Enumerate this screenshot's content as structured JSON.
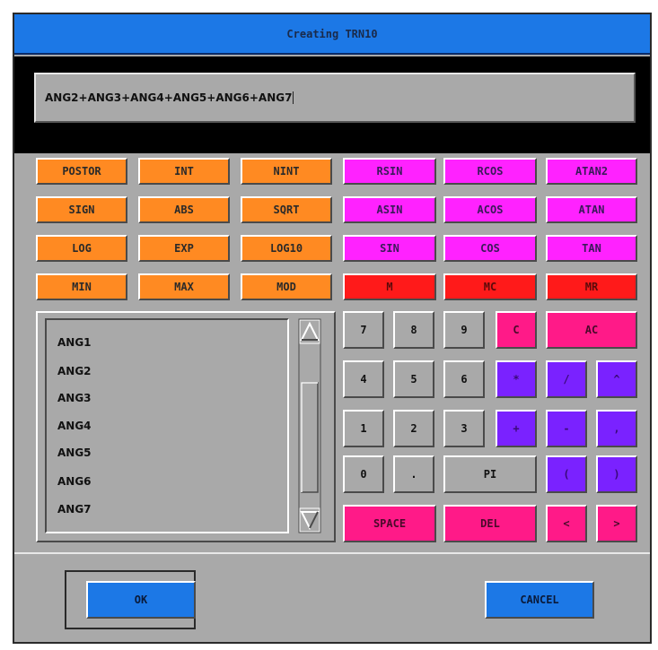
{
  "dialog": {
    "title": "Creating TRN10"
  },
  "expression": {
    "value": "ANG2+ANG3+ANG4+ANG5+ANG6+ANG7"
  },
  "function_buttons": [
    [
      "POSTOR",
      "INT",
      "NINT",
      "RSIN",
      "RCOS",
      "ATAN2"
    ],
    [
      "SIGN",
      "ABS",
      "SQRT",
      "ASIN",
      "ACOS",
      "ATAN"
    ],
    [
      "LOG",
      "EXP",
      "LOG10",
      "SIN",
      "COS",
      "TAN"
    ],
    [
      "MIN",
      "MAX",
      "MOD",
      "M",
      "MC",
      "MR"
    ]
  ],
  "variables": [
    "ANG1",
    "ANG2",
    "ANG3",
    "ANG4",
    "ANG5",
    "ANG6",
    "ANG7"
  ],
  "keypad": {
    "row1": [
      "7",
      "8",
      "9",
      "C",
      "AC"
    ],
    "row2": [
      "4",
      "5",
      "6",
      "*",
      "/",
      "^"
    ],
    "row3": [
      "1",
      "2",
      "3",
      "+",
      "-",
      ","
    ],
    "row4": [
      "0",
      ".",
      "PI",
      "(",
      ")"
    ],
    "row5": [
      "SPACE",
      "DEL",
      "<",
      ">"
    ]
  },
  "footer": {
    "ok_label": "OK",
    "cancel_label": "CANCEL"
  },
  "colors": {
    "titlebar": "#1c78e6",
    "orange": "#ff8a22",
    "magenta": "#ff22ff",
    "red": "#ff1a1a",
    "pink": "#ff1a88",
    "purple": "#7a22ff",
    "panel": "#a9a9a9"
  }
}
